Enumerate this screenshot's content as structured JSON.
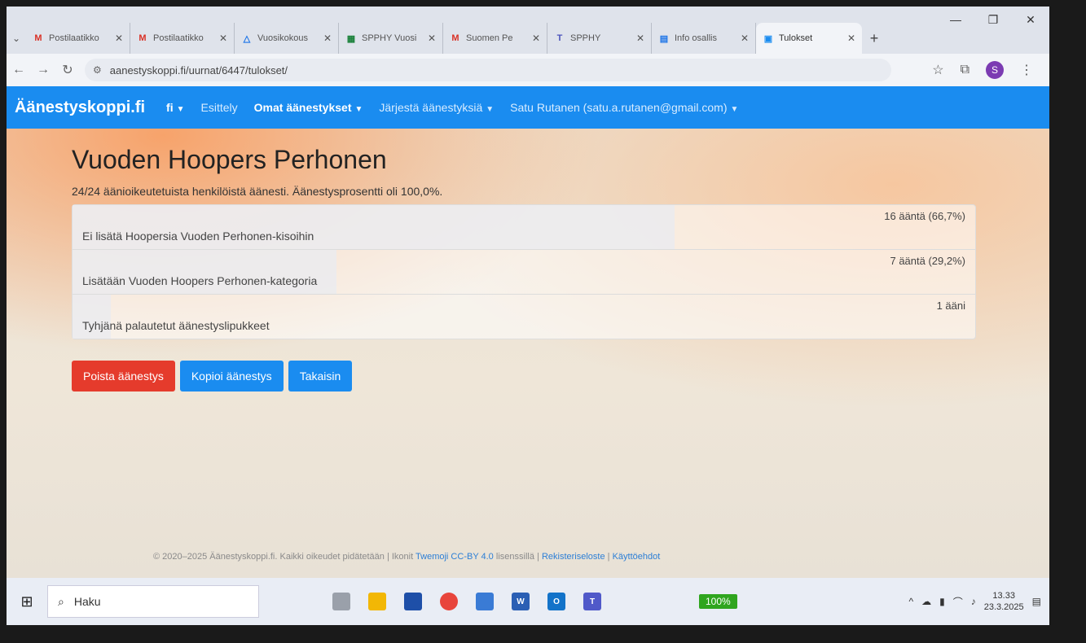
{
  "browser": {
    "tabs": [
      {
        "title": "Postilaatikko",
        "icon": "gmail-icon",
        "color": "#d93025",
        "active": false
      },
      {
        "title": "Postilaatikko",
        "icon": "gmail-icon",
        "color": "#d93025",
        "active": false
      },
      {
        "title": "Vuosikokous",
        "icon": "drive-icon",
        "color": "#1a73e8",
        "active": false
      },
      {
        "title": "SPPHY Vuosi",
        "icon": "sheets-icon",
        "color": "#188038",
        "active": false
      },
      {
        "title": "Suomen Pe",
        "icon": "gmail-icon",
        "color": "#d93025",
        "active": false
      },
      {
        "title": "SPPHY",
        "icon": "teams-icon",
        "color": "#4b53bc",
        "active": false
      },
      {
        "title": "Info osallis",
        "icon": "docs-icon",
        "color": "#1a73e8",
        "active": false
      },
      {
        "title": "Tulokset",
        "icon": "ballot-icon",
        "color": "#1a8cf0",
        "active": true
      }
    ],
    "url": "aanestyskoppi.fi/uurnat/6447/tulokset/"
  },
  "site": {
    "brand": "Äänestyskoppi.fi",
    "lang": "fi",
    "nav": {
      "intro": "Esittely",
      "my_votes": "Omat äänestykset",
      "organize": "Järjestä äänestyksiä",
      "user": "Satu Rutanen (satu.a.rutanen@gmail.com)"
    }
  },
  "main": {
    "title": "Vuoden Hoopers Perhonen",
    "summary": "24/24 äänioikeutetuista henkilöistä äänesti. Äänestysprosentti oli 100,0%.",
    "results": [
      {
        "votes": "16 ääntä (66,7%)",
        "label": "Ei lisätä Hoopersia Vuoden Perhonen-kisoihin",
        "share": 0.667
      },
      {
        "votes": "7 ääntä (29,2%)",
        "label": "Lisätään Vuoden Hoopers Perhonen-kategoria",
        "share": 0.292
      },
      {
        "votes": "1 ääni",
        "label": "Tyhjänä palautetut äänestyslipukkeet",
        "share": 0.042
      }
    ],
    "buttons": {
      "delete": "Poista äänestys",
      "copy": "Kopioi äänestys",
      "back": "Takaisin"
    }
  },
  "footer": {
    "text": "© 2020–2025 Äänestyskoppi.fi. Kaikki oikeudet pidätetään | Ikonit",
    "twemoji": "Twemoji CC-BY 4.0",
    "license": "lisenssillä |",
    "privacy": "Rekisteriseloste",
    "sep": "|",
    "terms": "Käyttöehdot"
  },
  "taskbar": {
    "search": "Haku",
    "zoom": "100%",
    "time": "13.33",
    "date": "23.3.2025"
  }
}
